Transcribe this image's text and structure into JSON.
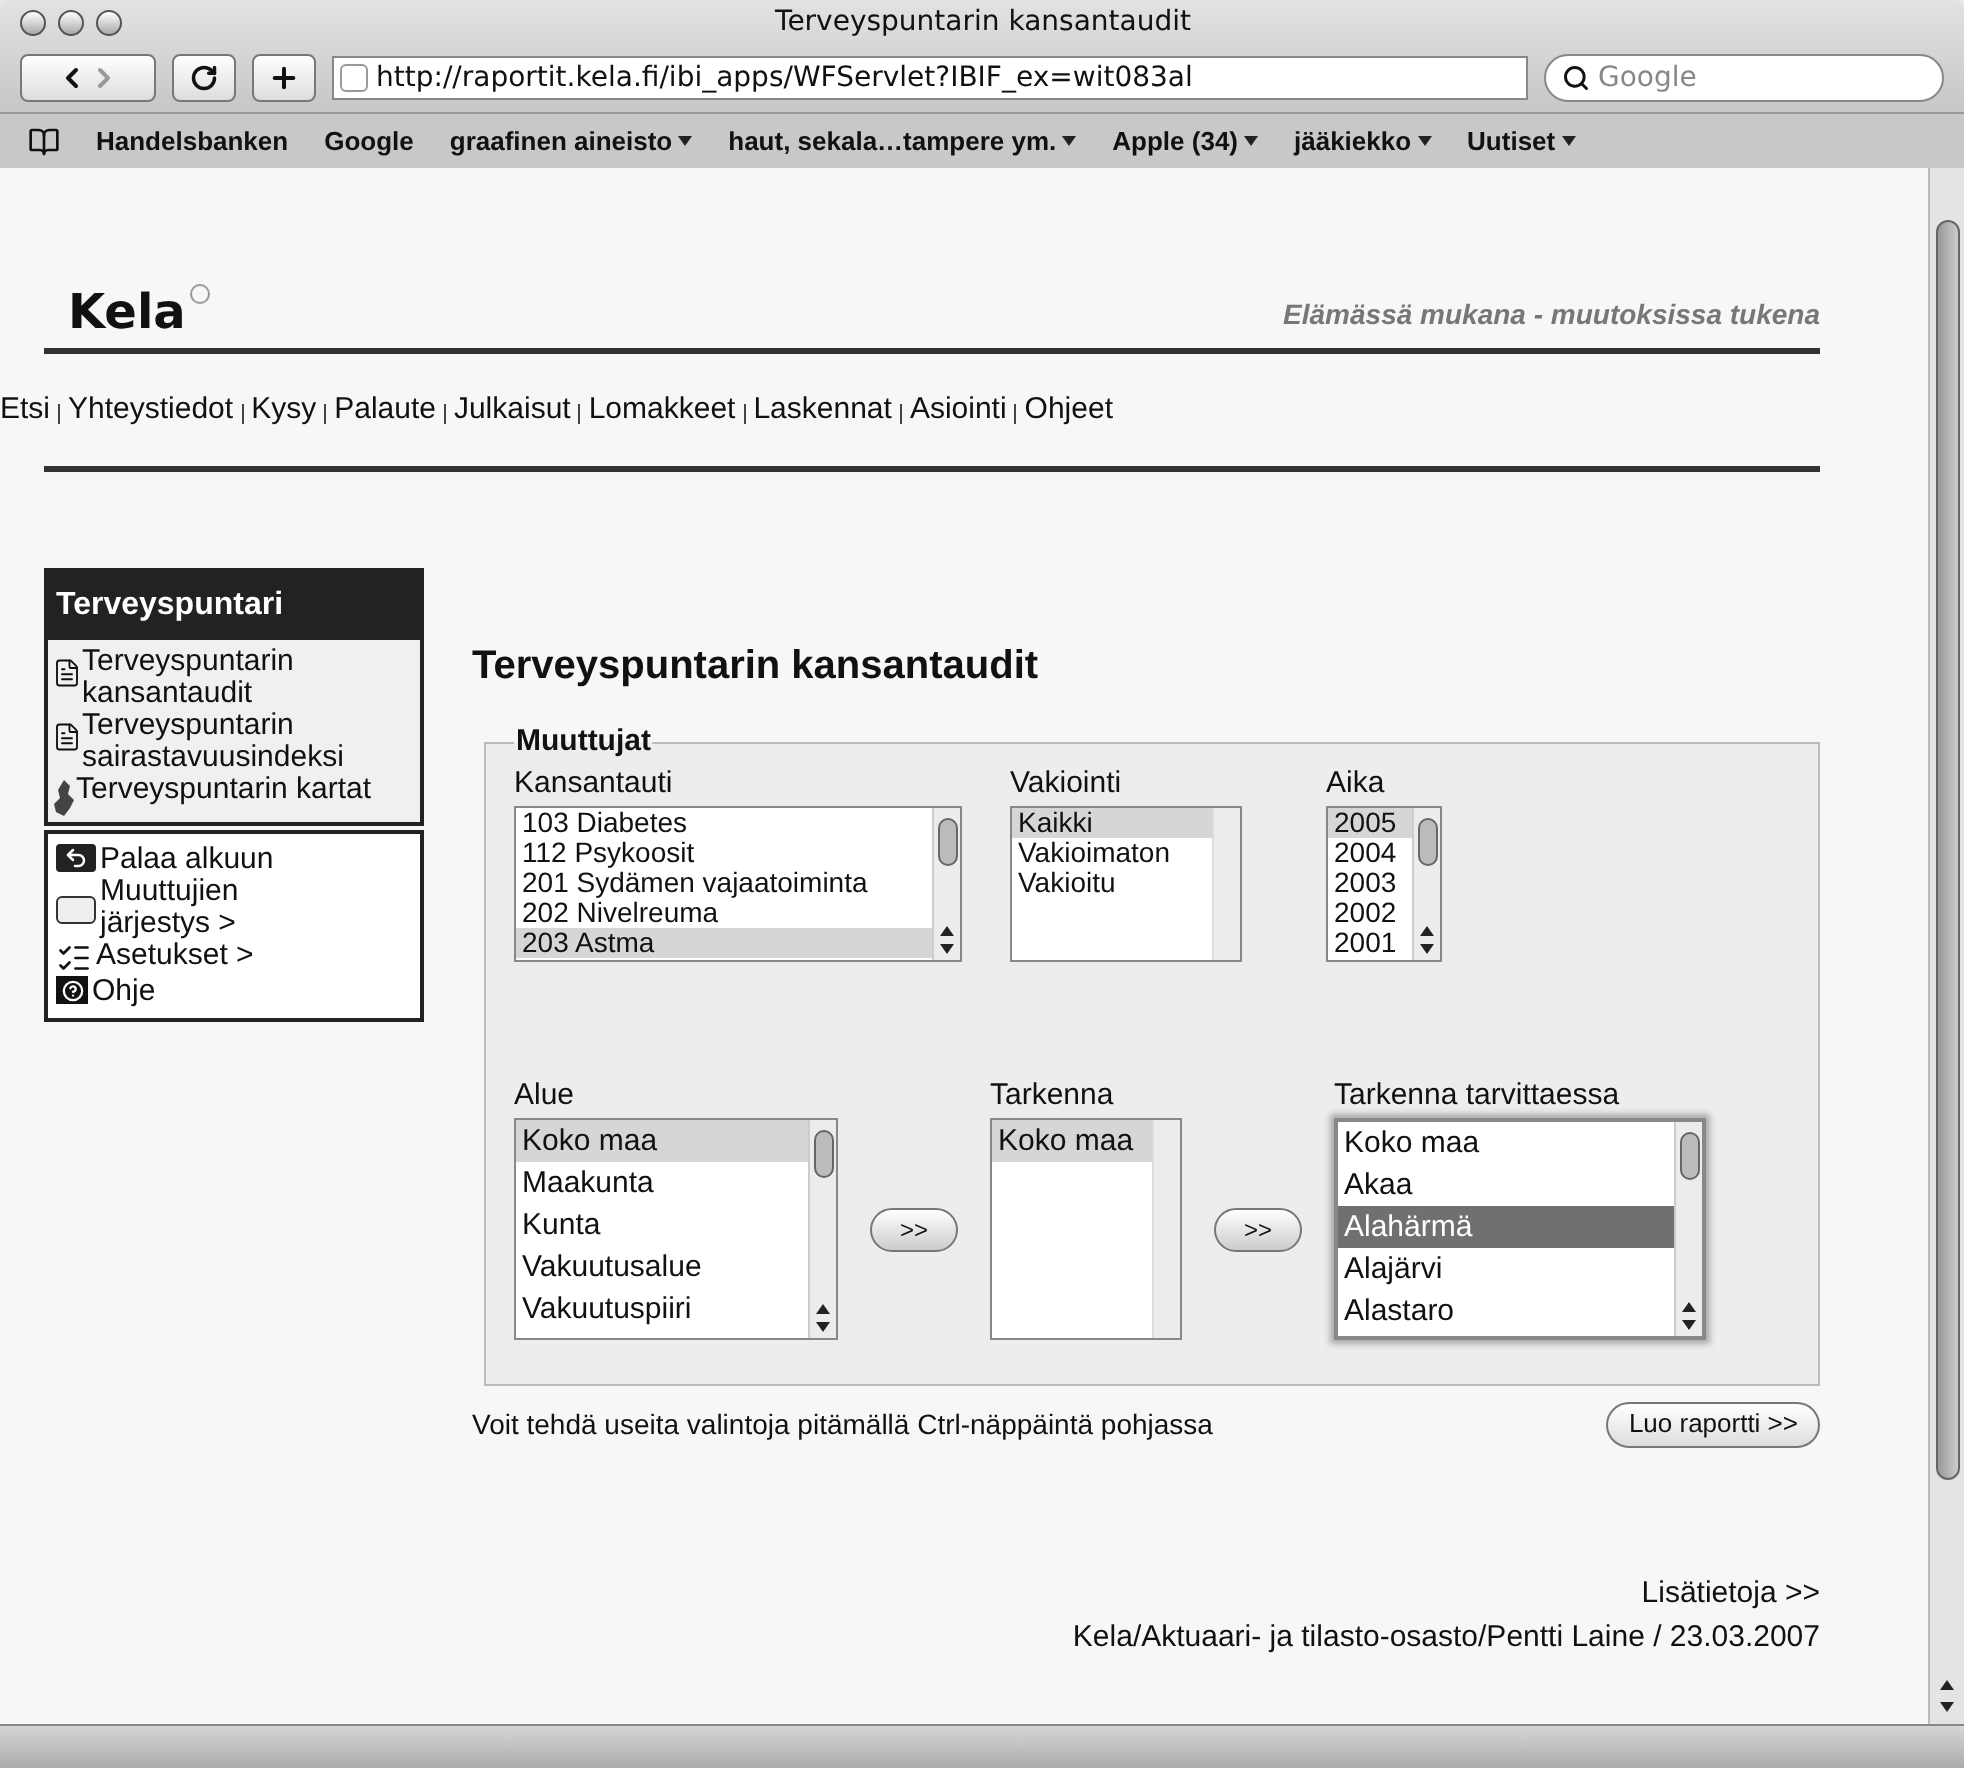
{
  "window": {
    "title": "Terveyspuntarin kansantaudit"
  },
  "toolbar": {
    "address": "http://raportit.kela.fi/ibi_apps/WFServlet?IBIF_ex=wit083al",
    "search": {
      "placeholder": "Google"
    }
  },
  "bookmarks": [
    {
      "label": "Handelsbanken",
      "menu": false
    },
    {
      "label": "Google",
      "menu": false
    },
    {
      "label": "graafinen aineisto",
      "menu": true
    },
    {
      "label": "haut, sekala…tampere ym.",
      "menu": true
    },
    {
      "label": "Apple (34)",
      "menu": true
    },
    {
      "label": "jääkiekko",
      "menu": true
    },
    {
      "label": "Uutiset",
      "menu": true
    }
  ],
  "site": {
    "logo": "Kela",
    "tagline": "Elämässä mukana - muutoksissa tukena",
    "nav": [
      "Etsi",
      "Yhteystiedot",
      "Kysy",
      "Palaute",
      "Julkaisut",
      "Lomakkeet",
      "Laskennat",
      "Asiointi",
      "Ohjeet"
    ]
  },
  "sidebar": {
    "title": "Terveyspuntari",
    "reports": [
      {
        "kind": "document",
        "label": "Terveyspuntarin kansantaudit"
      },
      {
        "kind": "document",
        "label": "Terveyspuntarin sairastavuusindeksi"
      },
      {
        "kind": "map",
        "label": "Terveyspuntarin kartat"
      }
    ],
    "actions": [
      {
        "kind": "back",
        "label": "Palaa alkuun"
      },
      {
        "kind": "order",
        "label": "Muuttujien järjestys >"
      },
      {
        "kind": "settings",
        "label": "Asetukset >"
      },
      {
        "kind": "help",
        "label": "Ohje"
      }
    ]
  },
  "main": {
    "title": "Terveyspuntarin kansantaudit",
    "fieldset": "Muuttujat",
    "lists": [
      {
        "label": "Kansantauti",
        "scrollable": true,
        "focused": false,
        "items": [
          {
            "label": "103 Diabetes",
            "selected": false
          },
          {
            "label": "112 Psykoosit",
            "selected": false
          },
          {
            "label": "201 Sydämen vajaatoiminta",
            "selected": false
          },
          {
            "label": "202 Nivelreuma",
            "selected": false
          },
          {
            "label": "203 Astma",
            "selected": true
          }
        ]
      },
      {
        "label": "Vakiointi",
        "scrollable": false,
        "focused": false,
        "items": [
          {
            "label": "Kaikki",
            "selected": true
          },
          {
            "label": "Vakioimaton",
            "selected": false
          },
          {
            "label": "Vakioitu",
            "selected": false
          }
        ]
      },
      {
        "label": "Aika",
        "scrollable": true,
        "focused": false,
        "items": [
          {
            "label": "2005",
            "selected": true
          },
          {
            "label": "2004",
            "selected": false
          },
          {
            "label": "2003",
            "selected": false
          },
          {
            "label": "2002",
            "selected": false
          },
          {
            "label": "2001",
            "selected": false
          }
        ]
      },
      {
        "label": "Alue",
        "scrollable": true,
        "focused": false,
        "items": [
          {
            "label": "Koko maa",
            "selected": true
          },
          {
            "label": "Maakunta",
            "selected": false
          },
          {
            "label": "Kunta",
            "selected": false
          },
          {
            "label": "Vakuutusalue",
            "selected": false
          },
          {
            "label": "Vakuutuspiiri",
            "selected": false
          }
        ]
      },
      {
        "label": "Tarkenna",
        "scrollable": false,
        "focused": false,
        "items": [
          {
            "label": "Koko maa",
            "selected": true
          }
        ]
      },
      {
        "label": "Tarkenna tarvittaessa",
        "scrollable": true,
        "focused": true,
        "items": [
          {
            "label": "Koko maa",
            "selected": false
          },
          {
            "label": "Akaa",
            "selected": false
          },
          {
            "label": "Alahärmä",
            "selected": true
          },
          {
            "label": "Alajärvi",
            "selected": false
          },
          {
            "label": "Alastaro",
            "selected": false
          }
        ]
      }
    ],
    "move_buttons": [
      ">>",
      ">>"
    ],
    "hint": "Voit tehdä useita valintoja pitämällä Ctrl-näppäintä pohjassa",
    "submit": "Luo raportti >>",
    "more": "Lisätietoja >>",
    "credit": "Kela/Aktuaari- ja tilasto-osasto/Pentti Laine / 23.03.2007"
  }
}
